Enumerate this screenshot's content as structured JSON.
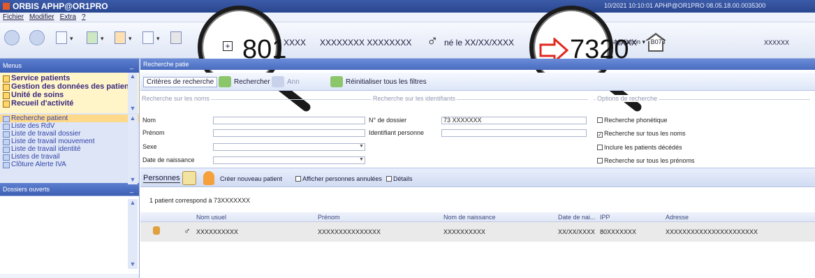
{
  "window": {
    "title": "ORBIS APHP@OR1PRO",
    "right_info": "10/2021 10:10:01    APHP@OR1PRO 08.05.18.00.0035300"
  },
  "menu": {
    "items": [
      "Fichier",
      "Modifier",
      "Extra",
      "?"
    ]
  },
  "banner": {
    "patient_number_zoomed": "801",
    "name_placeholder_1": "XXXX",
    "name_placeholder_2": "XXXXXXXX XXXXXXXX",
    "gender_symbol": "♂",
    "birth_text": "né le XX/XX/XXXX",
    "case_number_zoomed": "7320",
    "case_suffix": "XXXX",
    "reanimation_label": "réanimation",
    "unit_code": "B073",
    "right_placeholder": "XXXXXX"
  },
  "left_panel": {
    "header": "Menus",
    "modules": [
      "Service patients",
      "Gestion des données des patien",
      "Unité de soins",
      "Recueil d'activité"
    ],
    "worklists": [
      "Recherche patient",
      "Liste des RdV",
      "Liste de travail dossier",
      "Liste de travail mouvement",
      "Liste de travail identité",
      "Listes de travail",
      "Clôture Alerte IVA"
    ],
    "selected_index": 0,
    "dossiers_header": "Dossiers ouverts"
  },
  "main": {
    "header": "Recherche patie",
    "criteria_tab": "Critères de recherche",
    "search_btn": "Rechercher",
    "cancel_btn": "Ann",
    "reset_btn": "Réinitialiser tous les filtres",
    "legend_names": "Recherche sur les noms",
    "legend_ids": "Recherche sur les identifiants",
    "legend_opts": "Options de recherche",
    "labels": {
      "nom": "Nom",
      "prenom": "Prénom",
      "sexe": "Sexe",
      "naissance": "Date de naissance",
      "dossier": "N° de dossier",
      "identifiant": "Identifiant personne"
    },
    "values": {
      "dossier": "73 XXXXXXX"
    },
    "options": [
      {
        "label": "Recherche phonétique",
        "checked": ""
      },
      {
        "label": "Recherche sur tous les noms",
        "checked": "✓"
      },
      {
        "label": "Inclure les patients décédés",
        "checked": ""
      },
      {
        "label": "Recherche sur tous les prénoms",
        "checked": ""
      }
    ],
    "persons_tab": "Personnes",
    "create_patient": "Créer nouveau patient",
    "show_cancelled": "Afficher personnes annulées",
    "details": "Détails",
    "count_text": "1 patient correspond à 73XXXXXXX",
    "columns": [
      "Nom usuel",
      "Prénom",
      "Nom de naissance",
      "Date de nai...",
      "IPP",
      "Adresse"
    ],
    "row": {
      "gender": "♂",
      "nom": "XXXXXXXXXX",
      "prenom": "XXXXXXXXXXXXXXX",
      "naissance_nom": "XXXXXXXXXX",
      "date": "XX/XX/XXXX",
      "ipp": "80XXXXXXX",
      "adresse": "XXXXXXXXXXXXXXXXXXXXXX"
    }
  }
}
